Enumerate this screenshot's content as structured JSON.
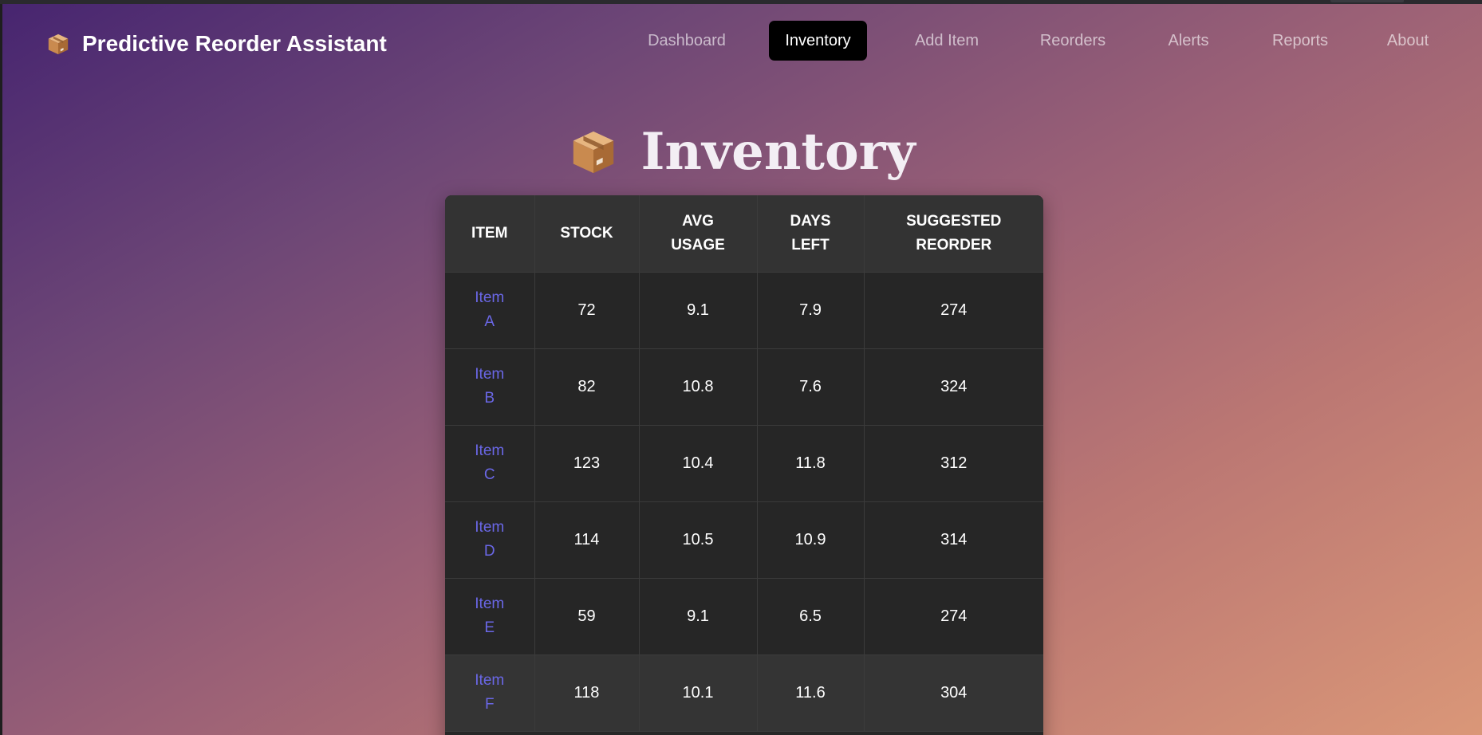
{
  "app": {
    "brand_title": "Predictive Reorder Assistant",
    "brand_icon": "package-icon"
  },
  "nav": {
    "items": [
      {
        "label": "Dashboard",
        "active": false
      },
      {
        "label": "Inventory",
        "active": true
      },
      {
        "label": "Add Item",
        "active": false
      },
      {
        "label": "Reorders",
        "active": false
      },
      {
        "label": "Alerts",
        "active": false
      },
      {
        "label": "Reports",
        "active": false
      },
      {
        "label": "About",
        "active": false
      }
    ]
  },
  "page": {
    "title": "Inventory",
    "title_icon": "package-icon"
  },
  "table": {
    "columns": [
      "Item",
      "Stock",
      "Avg Usage",
      "Days Left",
      "Suggested Reorder"
    ],
    "rows": [
      {
        "item": "Item A",
        "stock": "72",
        "avg_usage": "9.1",
        "days_left": "7.9",
        "suggested_reorder": "274"
      },
      {
        "item": "Item B",
        "stock": "82",
        "avg_usage": "10.8",
        "days_left": "7.6",
        "suggested_reorder": "324"
      },
      {
        "item": "Item C",
        "stock": "123",
        "avg_usage": "10.4",
        "days_left": "11.8",
        "suggested_reorder": "312"
      },
      {
        "item": "Item D",
        "stock": "114",
        "avg_usage": "10.5",
        "days_left": "10.9",
        "suggested_reorder": "314"
      },
      {
        "item": "Item E",
        "stock": "59",
        "avg_usage": "9.1",
        "days_left": "6.5",
        "suggested_reorder": "274"
      },
      {
        "item": "Item F",
        "stock": "118",
        "avg_usage": "10.1",
        "days_left": "11.6",
        "suggested_reorder": "304"
      }
    ]
  },
  "colors": {
    "link": "#6a67e6",
    "nav_active_bg": "#000000",
    "table_bg": "#262626",
    "table_header_bg": "#333333"
  }
}
